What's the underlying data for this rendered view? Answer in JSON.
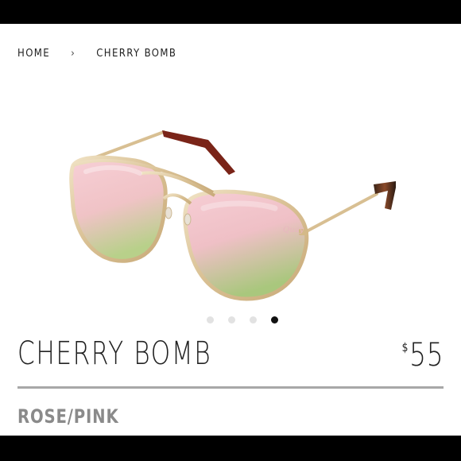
{
  "breadcrumb": {
    "items": [
      "HOME",
      "CHERRY BOMB"
    ],
    "separator": "›"
  },
  "gallery": {
    "image_alt": "Cherry Bomb sunglasses",
    "dot_count": 4,
    "active_index": 3
  },
  "product": {
    "title": "CHERRY BOMB",
    "currency": "$",
    "price": "55",
    "color": "ROSE/PINK"
  },
  "colors": {
    "frame_gold": "#d8bf92",
    "lens_pink": "#f2c4c8",
    "lens_green": "#b9cf8a",
    "temple_tip": "#7a2418",
    "text_dark": "#222222",
    "text_muted": "#8a8a8a",
    "divider": "#a8a8a8"
  }
}
